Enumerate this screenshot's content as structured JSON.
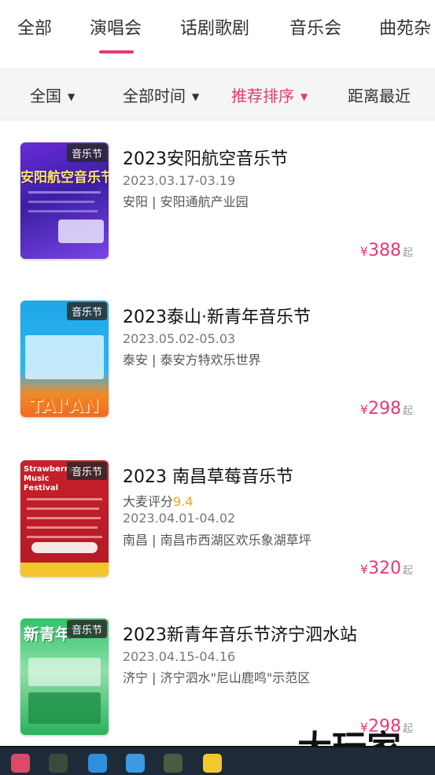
{
  "tabs": [
    {
      "label": "全部",
      "active": false
    },
    {
      "label": "演唱会",
      "active": true
    },
    {
      "label": "话剧歌剧",
      "active": false
    },
    {
      "label": "音乐会",
      "active": false
    },
    {
      "label": "曲苑杂",
      "active": false
    }
  ],
  "filters": [
    {
      "label": "全国",
      "caret": "▼",
      "active": false
    },
    {
      "label": "全部时间",
      "caret": "▼",
      "active": false
    },
    {
      "label": "推荐排序",
      "caret": "▼",
      "active": true
    },
    {
      "label": "距离最近",
      "caret": "",
      "active": false
    }
  ],
  "colors": {
    "accent": "#e63a75",
    "score": "#f0a31d"
  },
  "events": [
    {
      "tag": "音乐节",
      "title": "2023安阳航空音乐节",
      "date": "2023.03.17-03.19",
      "venue": "安阳 | 安阳通航产业园",
      "price_prefix": "¥",
      "price": "388",
      "price_suffix": "起",
      "poster_text": "安阳航空音乐节"
    },
    {
      "tag": "音乐节",
      "title": "2023泰山·新青年音乐节",
      "date": "2023.05.02-05.03",
      "venue": "泰安 | 泰安方特欢乐世界",
      "price_prefix": "¥",
      "price": "298",
      "price_suffix": "起",
      "poster_text": "TAI'AN"
    },
    {
      "tag": "音乐节",
      "title": "2023 南昌草莓音乐节",
      "score_label": "大麦评分",
      "score_value": "9.4",
      "date": "2023.04.01-04.02",
      "venue": "南昌 | 南昌市西湖区欢乐象湖草坪",
      "price_prefix": "¥",
      "price": "320",
      "price_suffix": "起",
      "poster_text": "Strawberry Music Festival"
    },
    {
      "tag": "音乐节",
      "title": "2023新青年音乐节济宁泗水站",
      "date": "2023.04.15-04.16",
      "venue": "济宁 | 济宁泗水\"尼山鹿鸣\"示范区",
      "price_prefix": "¥",
      "price": "298",
      "price_suffix": "起",
      "poster_text": "新青年"
    }
  ],
  "watermark": "大玩家"
}
